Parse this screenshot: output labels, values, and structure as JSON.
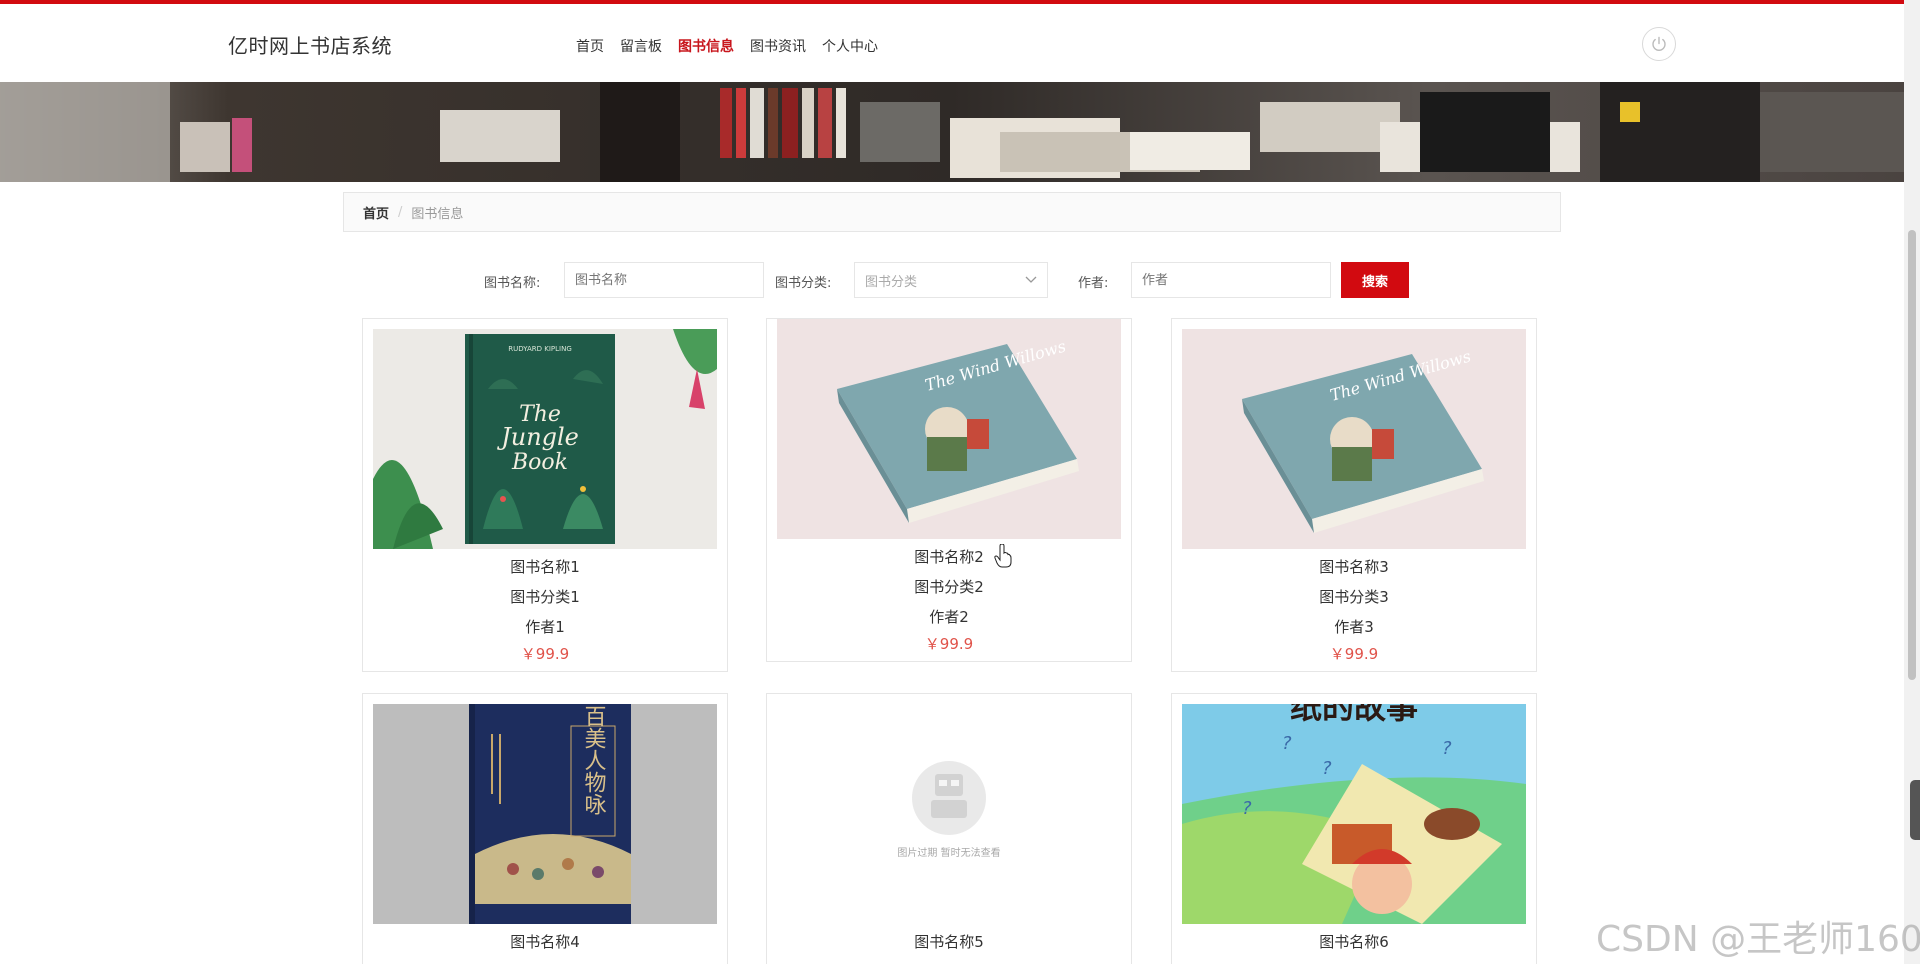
{
  "header": {
    "site_title": "亿时网上书店系统",
    "nav": [
      {
        "label": "首页",
        "active": false
      },
      {
        "label": "留言板",
        "active": false
      },
      {
        "label": "图书信息",
        "active": true
      },
      {
        "label": "图书资讯",
        "active": false
      },
      {
        "label": "个人中心",
        "active": false
      }
    ],
    "power_icon": "power-icon"
  },
  "breadcrumb": {
    "home": "首页",
    "separator": "/",
    "current": "图书信息"
  },
  "search": {
    "name_label": "图书名称:",
    "name_placeholder": "图书名称",
    "category_label": "图书分类:",
    "category_placeholder": "图书分类",
    "author_label": "作者:",
    "author_placeholder": "作者",
    "button": "搜索"
  },
  "books": [
    {
      "name": "图书名称1",
      "category": "图书分类1",
      "author": "作者1",
      "price": "￥99.9"
    },
    {
      "name": "图书名称2",
      "category": "图书分类2",
      "author": "作者2",
      "price": "￥99.9"
    },
    {
      "name": "图书名称3",
      "category": "图书分类3",
      "author": "作者3",
      "price": "￥99.9"
    },
    {
      "name": "图书名称4"
    },
    {
      "name": "图书名称5"
    },
    {
      "name": "图书名称6"
    }
  ],
  "cover_texts": {
    "book1_author": "RUDYARD KIPLING",
    "book1_title_1": "The",
    "book1_title_2": "Jungle",
    "book1_title_3": "Book",
    "book2_title": "The Wind Willows",
    "book4_title": "百美人物咏",
    "book6_title": "纸的故事",
    "placeholder_text": "图片过期 暂时无法查看"
  },
  "watermark": "CSDN @王老师160",
  "colors": {
    "accent": "#d20a10",
    "nav_active": "#c8161d",
    "price": "#e0534a"
  }
}
